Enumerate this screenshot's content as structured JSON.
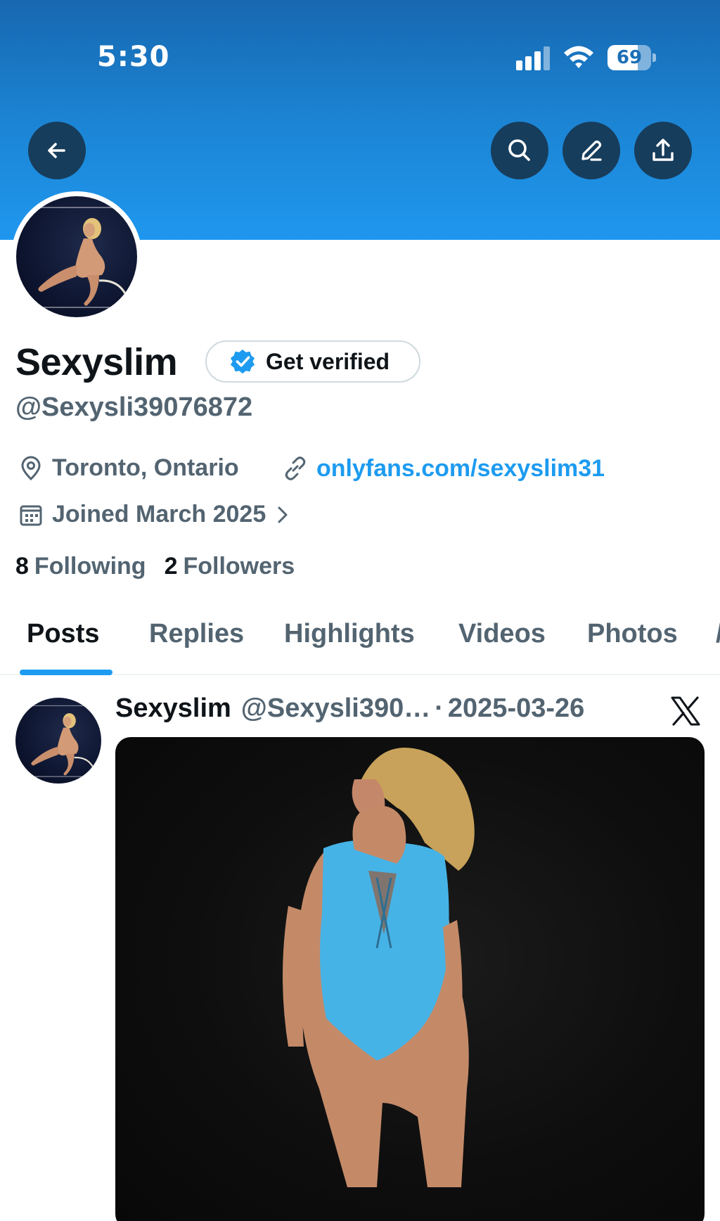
{
  "status_bar": {
    "time": "5:30",
    "battery": "69",
    "battery_level_percent": 69,
    "icons": [
      "signal-icon",
      "wifi-icon",
      "battery-icon"
    ]
  },
  "colors": {
    "banner": "#1c86d6",
    "accent": "#1d9bf0",
    "text_primary": "#0f1419",
    "text_secondary": "#536471",
    "header_button_bg": "#173d5c"
  },
  "header": {
    "buttons": [
      "back-arrow-icon",
      "search-icon",
      "edit-icon",
      "share-icon"
    ]
  },
  "profile": {
    "display_name": "Sexyslim",
    "verify_label": "Get verified",
    "handle": "@Sexysli39076872",
    "location": "Toronto, Ontario",
    "link": "onlyfans.com/sexyslim31",
    "joined": "Joined March 2025",
    "following_count": "8",
    "following_label": "Following",
    "followers_count": "2",
    "followers_label": "Followers"
  },
  "tabs": [
    {
      "label": "Posts",
      "active": true
    },
    {
      "label": "Replies",
      "active": false
    },
    {
      "label": "Highlights",
      "active": false
    },
    {
      "label": "Videos",
      "active": false
    },
    {
      "label": "Photos",
      "active": false
    }
  ],
  "post": {
    "name": "Sexyslim",
    "handle": "@Sexysli390…",
    "separator": "·",
    "date": "2025-03-26",
    "source_icon": "x-logo-icon"
  }
}
